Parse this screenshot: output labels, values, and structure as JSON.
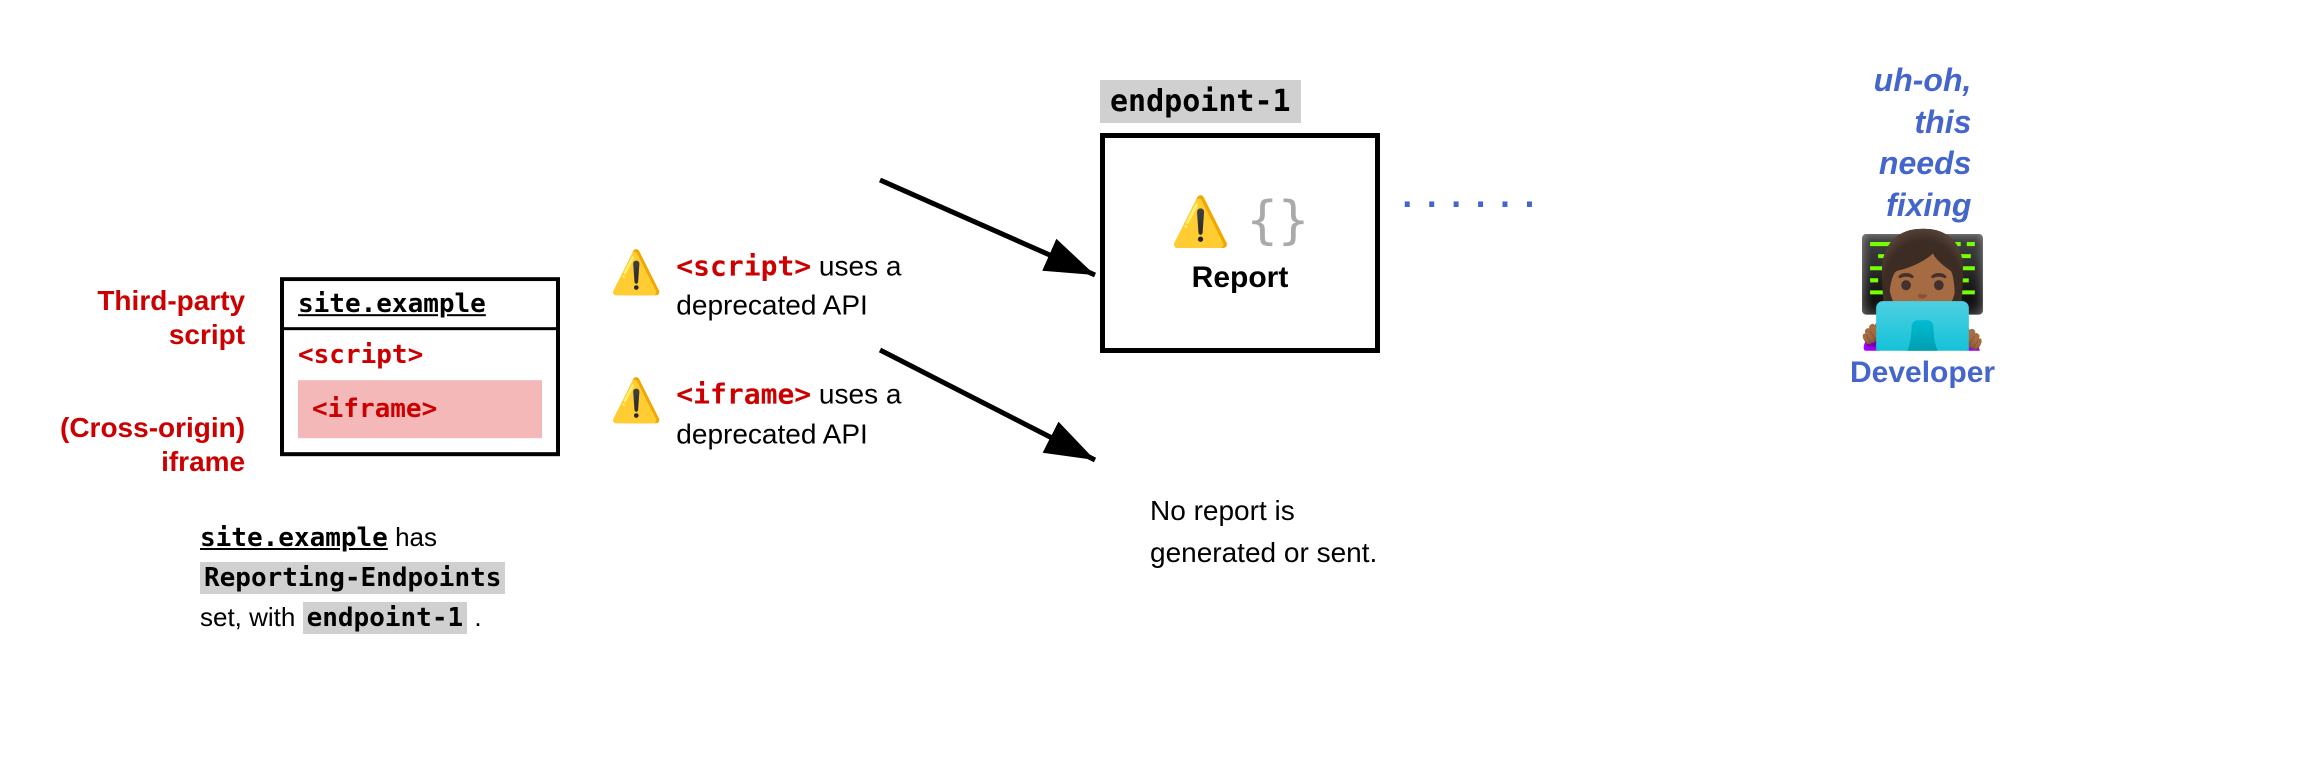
{
  "left_labels": {
    "third_party": "Third-party\nscript",
    "cross_origin": "(Cross-origin)\niframe"
  },
  "site_box": {
    "header": "site.example",
    "script_tag": "<script>",
    "iframe_tag": "<iframe>"
  },
  "site_caption": {
    "line1_mono": "site.example",
    "line1_rest": " has",
    "line2": "Reporting-Endpoints",
    "line3_start": "set, with ",
    "line3_highlight": "endpoint-1",
    "line3_end": " ."
  },
  "warnings": [
    {
      "icon": "⚠️",
      "red_tag": "<script>",
      "rest": " uses a\ndeprecated API"
    },
    {
      "icon": "⚠️",
      "red_tag": "<iframe>",
      "rest": " uses a\ndeprecated API"
    }
  ],
  "endpoint": {
    "label": "endpoint-1",
    "warning_icon": "⚠️",
    "curly": "{}",
    "report_label": "Report"
  },
  "no_report": {
    "text": "No report is\ngenerated or sent."
  },
  "dots": "......",
  "developer": {
    "speech": "uh-oh,\nthis\nneeds\nfixing",
    "emoji": "👩🏾‍💻",
    "label": "Developer"
  }
}
